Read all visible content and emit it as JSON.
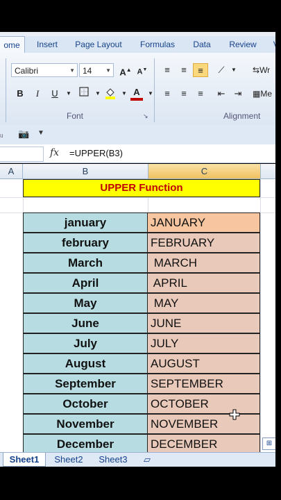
{
  "ribbon": {
    "tabs": [
      "ome",
      "Insert",
      "Page Layout",
      "Formulas",
      "Data",
      "Review",
      "Vi"
    ],
    "font_name": "Calibri",
    "font_size": "14",
    "group_font": "Font",
    "group_alignment": "Alignment",
    "wrap_label": "Wr",
    "merge_label": "Me",
    "bold": "B",
    "italic": "I",
    "underline": "U",
    "font_color_glyph": "A",
    "grow_font": "A",
    "shrink_font": "A",
    "accent_color": "#fbd87c"
  },
  "formula_bar": {
    "fx": "fx",
    "formula": "=UPPER(B3)"
  },
  "columns": {
    "a": "A",
    "b": "B",
    "c": "C"
  },
  "sheet": {
    "title": "UPPER Function",
    "rows": [
      {
        "month": "january",
        "upper": "JANUARY"
      },
      {
        "month": "february",
        "upper": "FEBRUARY"
      },
      {
        "month": "March",
        "upper": " MARCH"
      },
      {
        "month": "April",
        "upper": " APRIL"
      },
      {
        "month": "May",
        "upper": " MAY"
      },
      {
        "month": "June",
        "upper": "JUNE"
      },
      {
        "month": "July",
        "upper": "JULY"
      },
      {
        "month": "August",
        "upper": "AUGUST"
      },
      {
        "month": "September",
        "upper": "SEPTEMBER"
      },
      {
        "month": "October",
        "upper": "OCTOBER"
      },
      {
        "month": "November",
        "upper": "NOVEMBER"
      },
      {
        "month": "December",
        "upper": "DECEMBER"
      }
    ]
  },
  "sheet_tabs": [
    "Sheet1",
    "Sheet2",
    "Sheet3"
  ]
}
